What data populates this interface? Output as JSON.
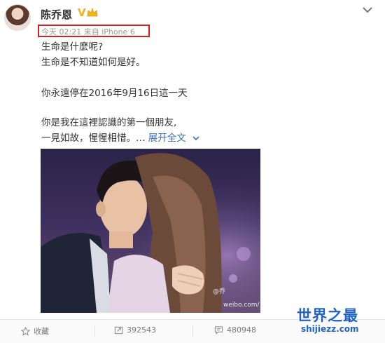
{
  "header": {
    "username": "陈乔恩",
    "verified_badge": "V",
    "meta": "今天 02:21 来自 iPhone 6",
    "icons": [
      "avatar",
      "crown-icon",
      "chevron-down-icon"
    ]
  },
  "post": {
    "lines": [
      "生命是什麼呢?",
      "生命是不知道如何是好。",
      "你永遠停在2016年9月16日這一天",
      "你是我在這裡認識的第一個朋友,",
      "一見如故，惺惺相惜。…"
    ],
    "expand_label": "展开全文"
  },
  "image": {
    "watermark_top": "@乔",
    "watermark_bottom": "weibo.com/"
  },
  "actions": {
    "favorite_label": "收藏",
    "repost_count": "392543",
    "comment_count": "480948"
  },
  "site": {
    "logo_text": "世界之最",
    "url": "shijiezz.com"
  },
  "colors": {
    "highlight_box": "#d9201f",
    "link": "#3b6fb6",
    "verified": "#f6b21b",
    "site_logo": "#1f63c9"
  }
}
